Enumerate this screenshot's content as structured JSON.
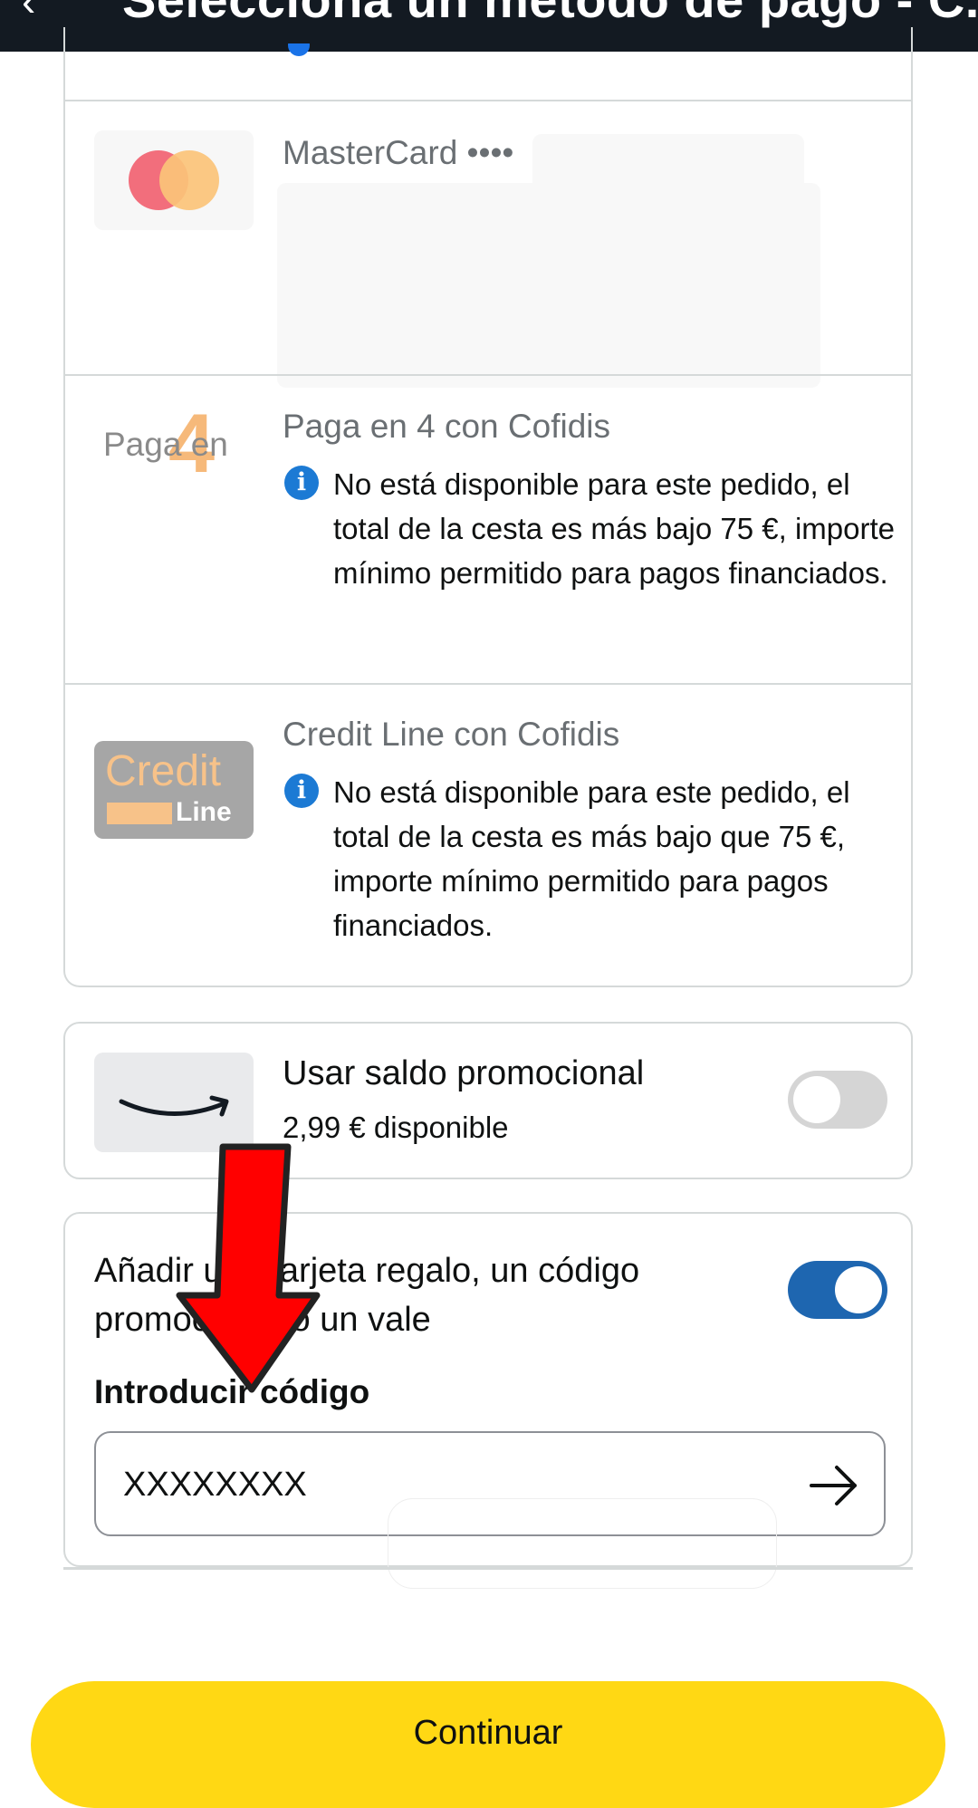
{
  "header": {
    "back_glyph": "‹",
    "title": "Selecciona un método de pago - C..."
  },
  "methods": [
    {
      "id": "mastercard",
      "title": "MasterCard ••••",
      "logo_colors": [
        "#f26e7c",
        "#fbc378"
      ]
    },
    {
      "id": "paga-en-4",
      "title": "Paga en 4 con Cofidis",
      "logo_text": "Paga en",
      "logo_number": "4",
      "info": "No está disponible para este pedido, el total de la cesta es más bajo 75 €, importe mínimo permitido para pagos financiados."
    },
    {
      "id": "credit-line",
      "title": "Credit Line con Cofidis",
      "logo_word": "Credit",
      "logo_sub": "Line",
      "info": "No está disponible para este pedido, el total de la cesta es más bajo que 75 €, importe mínimo permitido para pagos financiados."
    }
  ],
  "promo_balance": {
    "title": "Usar saldo promocional",
    "amount": "2,99 € disponible",
    "toggle_on": false
  },
  "gift_card": {
    "title": "Añadir una tarjeta regalo, un código promocional o un vale",
    "toggle_on": true,
    "code_label": "Introducir código",
    "code_value": "XXXXXXXX"
  },
  "continue_label": "Continuar",
  "colors": {
    "header_bg": "#131a22",
    "info_icon": "#1c7ad4",
    "toggle_on": "#1e66b0",
    "continue_bg": "#ffd814",
    "annotation": "#ff0000"
  }
}
